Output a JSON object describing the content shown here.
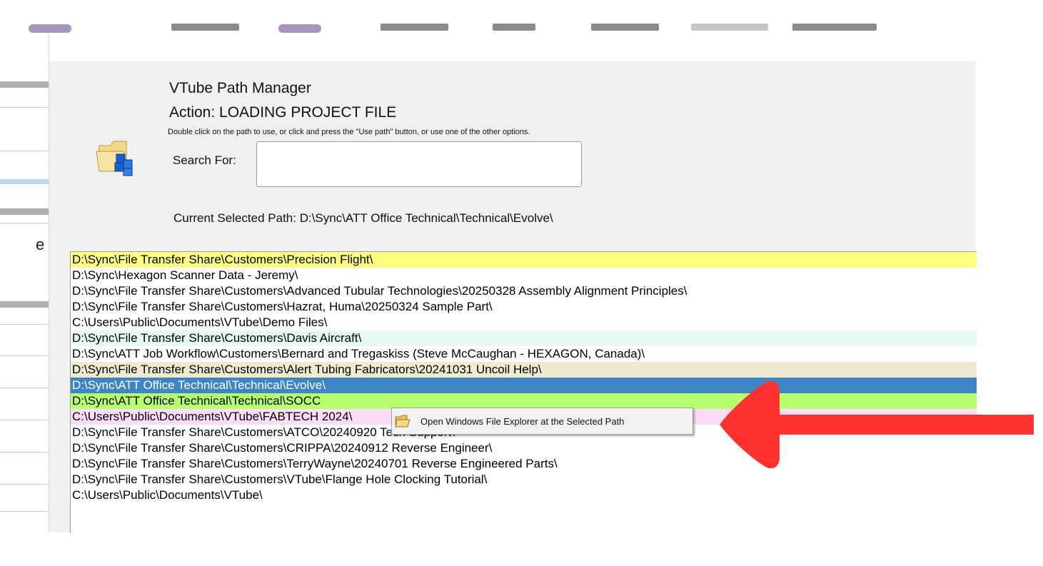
{
  "dialog": {
    "title": "VTube Path Manager",
    "action": "Action: LOADING PROJECT FILE",
    "hint": "Double click on the path to use, or click and press the \"Use path\" button, or use one of the other options.",
    "search_label": "Search For:",
    "search_value": "",
    "current_path": "Current Selected Path:  D:\\Sync\\ATT Office Technical\\Technical\\Evolve\\"
  },
  "paths": [
    {
      "text": "D:\\Sync\\File Transfer Share\\Customers\\Precision Flight\\",
      "bg": "#ffff80",
      "fg": "#000000"
    },
    {
      "text": "D:\\Sync\\Hexagon Scanner Data - Jeremy\\",
      "bg": "#ffffff",
      "fg": "#000000"
    },
    {
      "text": "D:\\Sync\\File Transfer Share\\Customers\\Advanced Tubular Technologies\\20250328 Assembly Alignment Principles\\",
      "bg": "#ffffff",
      "fg": "#000000"
    },
    {
      "text": "D:\\Sync\\File Transfer Share\\Customers\\Hazrat, Huma\\20250324 Sample Part\\",
      "bg": "#ffffff",
      "fg": "#000000"
    },
    {
      "text": "C:\\Users\\Public\\Documents\\VTube\\Demo Files\\",
      "bg": "#ffffff",
      "fg": "#000000"
    },
    {
      "text": "D:\\Sync\\File Transfer Share\\Customers\\Davis Aircraft\\",
      "bg": "#e6fbee",
      "fg": "#000000"
    },
    {
      "text": "D:\\Sync\\ATT Job Workflow\\Customers\\Bernard and Tregaskiss (Steve McCaughan - HEXAGON, Canada)\\",
      "bg": "#ffffff",
      "fg": "#000000"
    },
    {
      "text": "D:\\Sync\\File Transfer Share\\Customers\\Alert Tubing Fabricators\\20241031 Uncoil Help\\",
      "bg": "#eeebd0",
      "fg": "#000000"
    },
    {
      "text": "D:\\Sync\\ATT Office Technical\\Technical\\Evolve\\",
      "bg": "#3d85c6",
      "fg": "#ffffff"
    },
    {
      "text": "D:\\Sync\\ATT Office Technical\\Technical\\SOCC",
      "bg": "#b6ff6e",
      "fg": "#000000"
    },
    {
      "text": "C:\\Users\\Public\\Documents\\VTube\\FABTECH 2024\\",
      "bg": "#fddcf7",
      "fg": "#000000"
    },
    {
      "text": "D:\\Sync\\File Transfer Share\\Customers\\ATCO\\20240920 Tech Support\\",
      "bg": "#ffffff",
      "fg": "#000000"
    },
    {
      "text": "D:\\Sync\\File Transfer Share\\Customers\\CRIPPA\\20240912 Reverse Engineer\\",
      "bg": "#ffffff",
      "fg": "#000000"
    },
    {
      "text": "D:\\Sync\\File Transfer Share\\Customers\\TerryWayne\\20240701 Reverse Engineered Parts\\",
      "bg": "#ffffff",
      "fg": "#000000"
    },
    {
      "text": "D:\\Sync\\File Transfer Share\\Customers\\VTube\\Flange Hole Clocking Tutorial\\",
      "bg": "#ffffff",
      "fg": "#000000"
    },
    {
      "text": "C:\\Users\\Public\\Documents\\VTube\\",
      "bg": "#ffffff",
      "fg": "#000000"
    }
  ],
  "context_menu": {
    "item_label": "Open Windows File Explorer at the Selected Path",
    "icon": "folder-open-icon"
  },
  "annotation": {
    "arrow_color": "#ff3131",
    "icon": "red-arrow-icon"
  },
  "background_app": {
    "left_fragment": "e"
  }
}
